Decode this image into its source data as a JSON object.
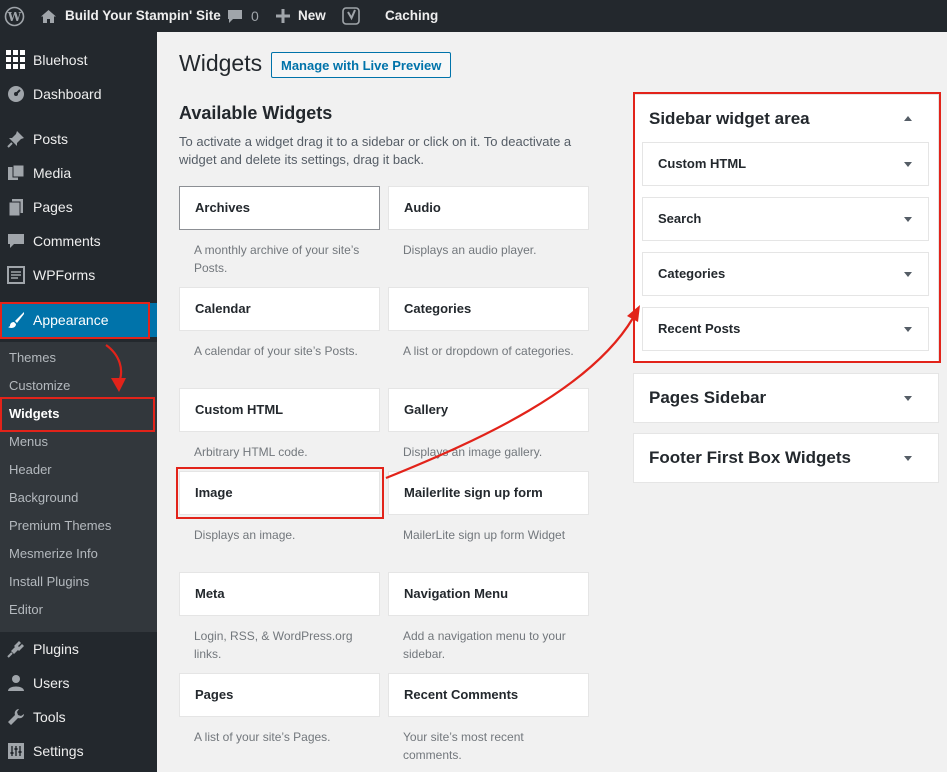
{
  "adminbar": {
    "site_name": "Build Your Stampin' Site",
    "comments_count": "0",
    "new_label": "New",
    "caching_label": "Caching"
  },
  "menu": {
    "items": [
      {
        "label": "Bluehost",
        "icon": "grid-icon"
      },
      {
        "label": "Dashboard",
        "icon": "dashboard-icon"
      },
      {
        "label": "Posts",
        "icon": "pin-icon"
      },
      {
        "label": "Media",
        "icon": "media-icon"
      },
      {
        "label": "Pages",
        "icon": "pages-icon"
      },
      {
        "label": "Comments",
        "icon": "comment-bubble-icon"
      },
      {
        "label": "WPForms",
        "icon": "forms-icon"
      },
      {
        "label": "Appearance",
        "icon": "paintbrush-icon"
      }
    ],
    "submenu": [
      "Themes",
      "Customize",
      "Widgets",
      "Menus",
      "Header",
      "Background",
      "Premium Themes",
      "Mesmerize Info",
      "Install Plugins",
      "Editor"
    ],
    "bottom_items": [
      {
        "label": "Plugins",
        "icon": "plug-icon"
      },
      {
        "label": "Users",
        "icon": "users-icon"
      },
      {
        "label": "Tools",
        "icon": "wrench-icon"
      },
      {
        "label": "Settings",
        "icon": "settings-icon"
      }
    ]
  },
  "page": {
    "title": "Widgets",
    "preview_button": "Manage with Live Preview",
    "available_title": "Available Widgets",
    "available_desc": "To activate a widget drag it to a sidebar or click on it. To deactivate a widget and delete its settings, drag it back."
  },
  "widgets": [
    {
      "title": "Archives",
      "desc": "A monthly archive of your site’s Posts."
    },
    {
      "title": "Audio",
      "desc": "Displays an audio player."
    },
    {
      "title": "Calendar",
      "desc": "A calendar of your site’s Posts."
    },
    {
      "title": "Categories",
      "desc": "A list or dropdown of categories."
    },
    {
      "title": "Custom HTML",
      "desc": "Arbitrary HTML code."
    },
    {
      "title": "Gallery",
      "desc": "Displays an image gallery."
    },
    {
      "title": "Image",
      "desc": "Displays an image."
    },
    {
      "title": "Mailerlite sign up form",
      "desc": "MailerLite sign up form Widget"
    },
    {
      "title": "Meta",
      "desc": "Login, RSS, & WordPress.org links."
    },
    {
      "title": "Navigation Menu",
      "desc": "Add a navigation menu to your sidebar."
    },
    {
      "title": "Pages",
      "desc": "A list of your site’s Pages."
    },
    {
      "title": "Recent Comments",
      "desc": "Your site’s most recent comments."
    }
  ],
  "sidebars": {
    "main": {
      "title": "Sidebar widget area",
      "widgets": [
        "Custom HTML",
        "Search",
        "Categories",
        "Recent Posts"
      ]
    },
    "pages_sidebar": "Pages Sidebar",
    "footer_first": "Footer First Box Widgets"
  },
  "colors": {
    "annotation": "#e2231a",
    "accent": "#0073aa",
    "adminbar": "#23282d"
  }
}
